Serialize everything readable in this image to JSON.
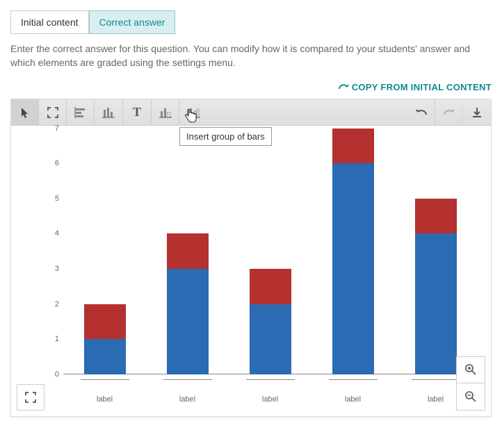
{
  "tabs": {
    "initial": "Initial content",
    "correct": "Correct answer"
  },
  "help_text": "Enter the correct answer for this question. You can modify how it is compared to your students' answer and which elements are graded using the settings menu.",
  "copy_link": "COPY FROM INITIAL CONTENT",
  "tooltip": "Insert group of bars",
  "chart_data": {
    "type": "bar",
    "stacked": true,
    "ylim": [
      0,
      7
    ],
    "y_ticks": [
      0,
      1,
      2,
      3,
      4,
      5,
      6,
      7
    ],
    "categories": [
      "label",
      "label",
      "label",
      "label",
      "label"
    ],
    "series": [
      {
        "name": "blue",
        "color": "#2a6bb3",
        "values": [
          1,
          3,
          2,
          6,
          4
        ]
      },
      {
        "name": "red",
        "color": "#b5312f",
        "values": [
          1,
          1,
          1,
          1,
          1
        ]
      }
    ],
    "totals": [
      2,
      4,
      3,
      7,
      5
    ]
  },
  "tool_names": {
    "select": "select",
    "fullscreen": "fullscreen",
    "hbar": "horizontal-bar",
    "vbar": "vertical-bar",
    "text": "text",
    "single_bar": "insert-single-bar",
    "group_bar": "insert-group-of-bars",
    "undo": "undo",
    "redo": "redo",
    "download": "download"
  }
}
